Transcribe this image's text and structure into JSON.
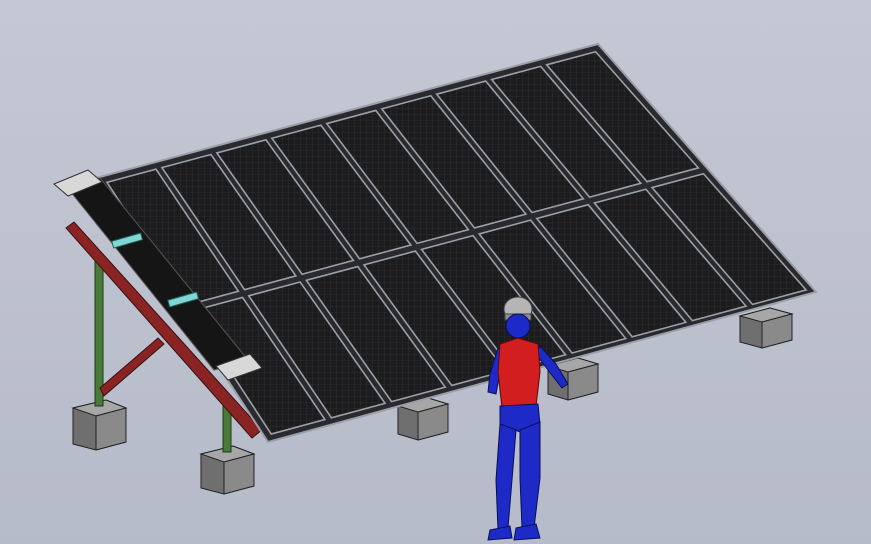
{
  "scene": {
    "panel_rows": 2,
    "panels_per_row": 9,
    "foundation_blocks": 5
  },
  "colors": {
    "background_top": "#c4c8d4",
    "background_bottom": "#b6bbc9",
    "panel_cell": "#1c1c1e",
    "panel_frame": "#9aa0a8",
    "rail": "#8a2424",
    "post": "#4a7a3a",
    "block_top": "#a7a7a7",
    "block_side": "#6f6f6f",
    "figure_body": "#1d2ac8",
    "figure_vest": "#d21e1e",
    "helmet": "#b5b5b5",
    "clamp": "#7fd6d2"
  }
}
